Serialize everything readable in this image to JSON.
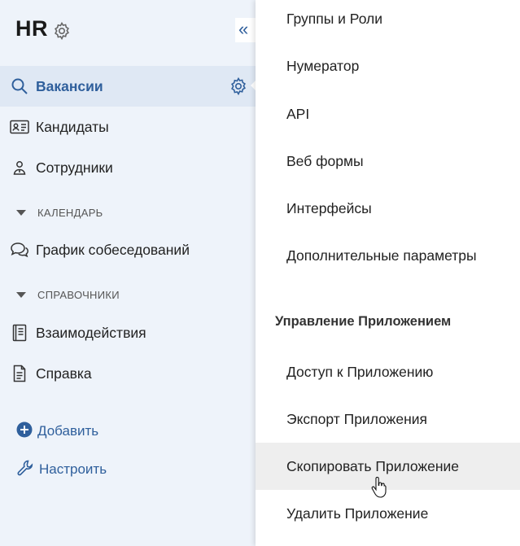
{
  "app": {
    "title": "HR"
  },
  "sidebar": {
    "collapse_glyph": "«",
    "items": [
      {
        "label": "Вакансии",
        "icon": "search-icon",
        "active": true
      },
      {
        "label": "Кандидаты",
        "icon": "id-card-icon"
      },
      {
        "label": "Сотрудники",
        "icon": "people-icon"
      }
    ],
    "sections": [
      {
        "label": "КАЛЕНДАРЬ",
        "items": [
          {
            "label": "График собеседований",
            "icon": "chat-bubbles-icon"
          }
        ]
      },
      {
        "label": "СПРАВОЧНИКИ",
        "items": [
          {
            "label": "Взаимодействия",
            "icon": "book-icon"
          },
          {
            "label": "Справка",
            "icon": "document-icon"
          }
        ]
      }
    ],
    "actions": [
      {
        "label": "Добавить",
        "icon": "plus-circle-icon"
      },
      {
        "label": "Настроить",
        "icon": "wrench-icon"
      }
    ]
  },
  "dropdown": {
    "items": [
      "Группы и Роли",
      "Нумератор",
      "API",
      "Веб формы",
      "Интерфейсы",
      "Дополнительные параметры"
    ],
    "section_header": "Управление Приложением",
    "app_items": [
      "Доступ к Приложению",
      "Экспорт Приложения",
      "Скопировать Приложение",
      "Удалить Приложение"
    ],
    "hovered_item": "Скопировать Приложение"
  },
  "colors": {
    "accent": "#2f5f9c",
    "sidebar_bg": "#eef3fa",
    "active_bg": "#dfe8f4",
    "hover_bg": "#eeeeee"
  }
}
